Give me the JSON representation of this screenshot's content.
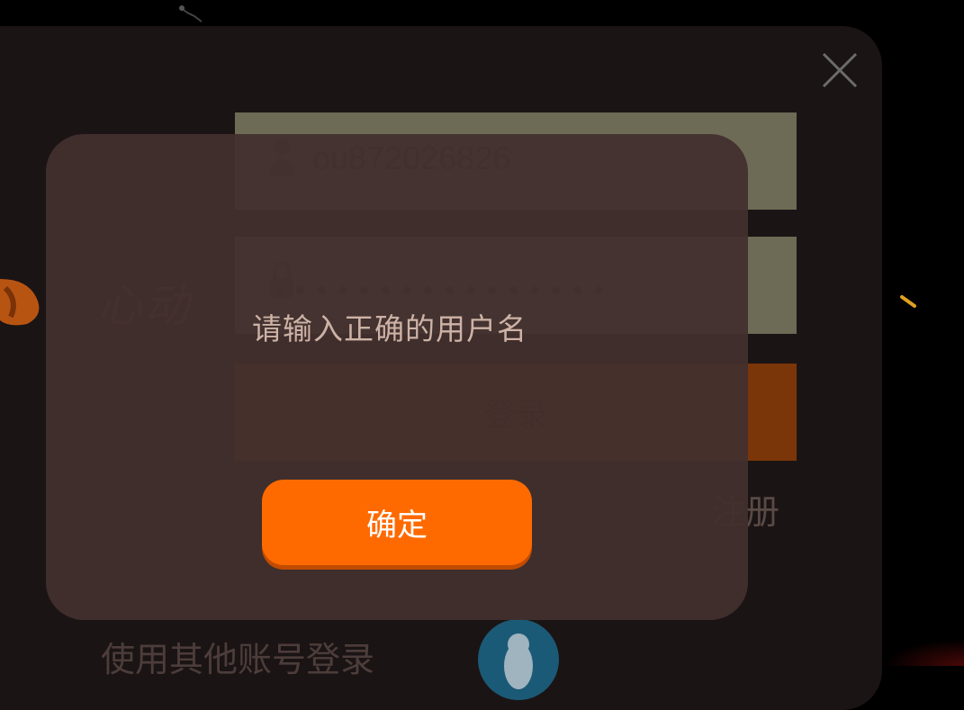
{
  "login": {
    "logo_text": "心动",
    "username_value": "ou872026826",
    "password_masked": "••••••••••••••••",
    "login_label": "登录",
    "register_label": "注册",
    "other_login_label": "使用其他账号登录"
  },
  "dialog": {
    "message": "请输入正确的用户名",
    "confirm_label": "确定"
  },
  "colors": {
    "accent": "#ff6a00",
    "modal_bg": "#42302e",
    "panel_bg": "#1b1414",
    "field_bg": "#6d6a55"
  },
  "icons": [
    "close-icon",
    "user-icon",
    "lock-icon",
    "qq-icon"
  ]
}
